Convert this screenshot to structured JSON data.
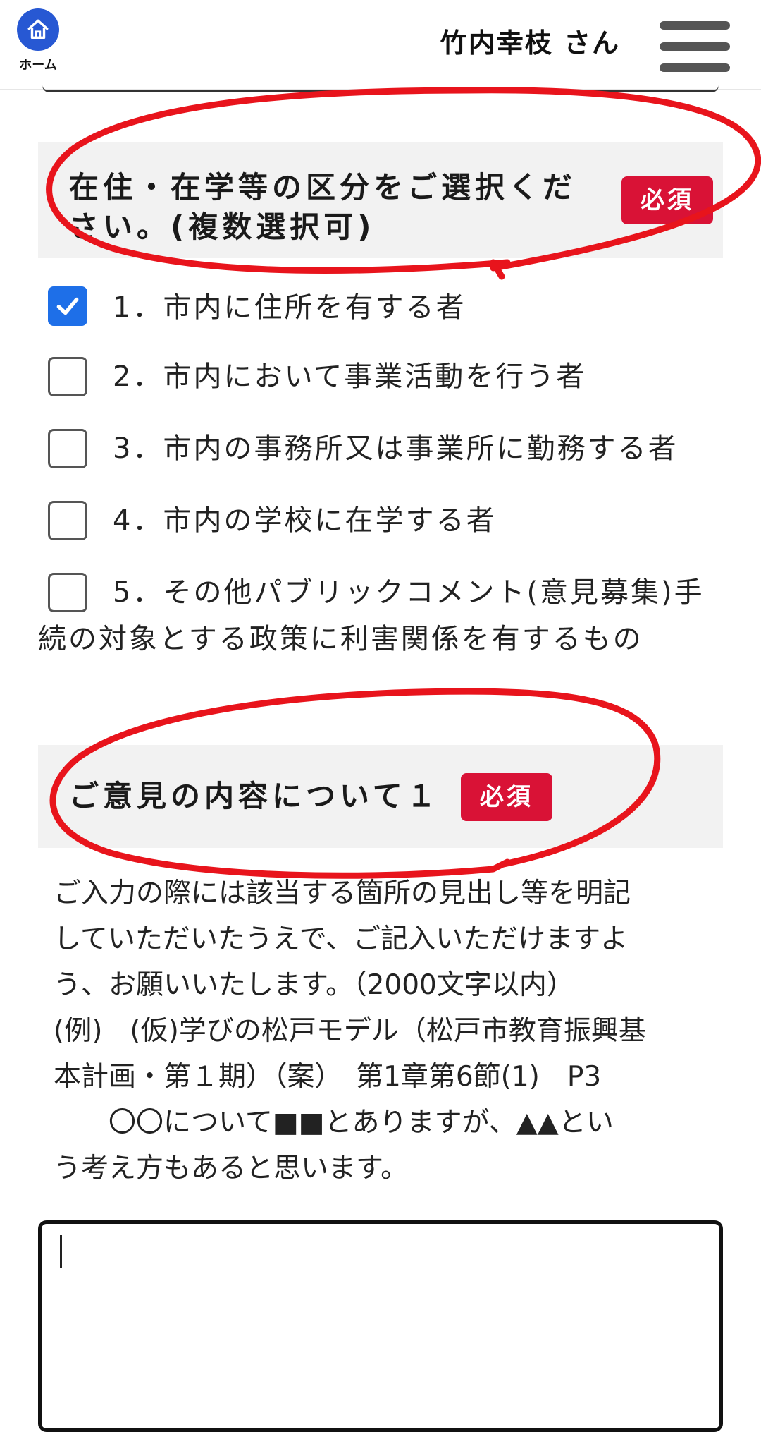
{
  "header": {
    "home_label": "ホーム",
    "user_name": "竹内幸枝 さん",
    "icons": [
      "home-icon",
      "hamburger-menu-icon"
    ]
  },
  "question1": {
    "title_line1": "在住・在学等の区分をご選択くだ",
    "title_line2": "さい。(複数選択可)",
    "required_badge": "必須",
    "options": [
      {
        "label": "1．市内に住所を有する者",
        "checked": true
      },
      {
        "label": "2．市内において事業活動を行う者",
        "checked": false
      },
      {
        "label": "3．市内の事務所又は事業所に勤務する者",
        "checked": false
      },
      {
        "label": "4．市内の学校に在学する者",
        "checked": false
      },
      {
        "label": "5．その他パブリックコメント(意見募集)手",
        "label_cont": "続の対象とする政策に利害関係を有するもの",
        "checked": false
      }
    ]
  },
  "question2": {
    "title": "ご意見の内容について１",
    "required_badge": "必須",
    "description_lines": [
      "ご入力の際には該当する箇所の見出し等を明記",
      "していただいたうえで、ご記入いただけますよ",
      "う、お願いいたします。（2000文字以内）",
      "(例)　(仮)学びの松戸モデル（松戸市教育振興基",
      "本計画・第１期）（案）　第1章第6節(1)　P3",
      "　　〇〇について■■とありますが、▲▲とい",
      "う考え方もあると思います。"
    ],
    "textarea_value": ""
  },
  "colors": {
    "accent_blue": "#1e6fe8",
    "home_blue": "#2758d3",
    "required_red": "#d91236",
    "annotation_red": "#e8141c",
    "section_bg": "#f2f2f2"
  }
}
